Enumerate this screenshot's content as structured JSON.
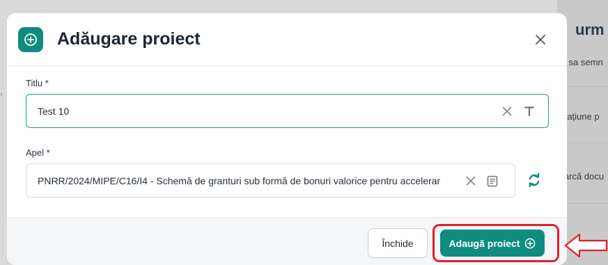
{
  "background": {
    "title": "urm",
    "lines": [
      "i sa semn",
      "rațiune p",
      "arcă docu"
    ]
  },
  "modal": {
    "title": "Adăugare proiect",
    "header_icon": "plus-circle-icon",
    "close_icon": "close-icon"
  },
  "form": {
    "title_field": {
      "label": "Titlu *",
      "value": "Test 10",
      "icons": [
        "clear-icon",
        "text-format-icon"
      ]
    },
    "apel_field": {
      "label": "Apel *",
      "value": "PNRR/2024/MIPE/C16/I4 - Schemă de granturi sub formă de bonuri valorice pentru accelerar",
      "icons": [
        "clear-icon",
        "document-list-icon"
      ]
    },
    "refresh_icon": "refresh-icon"
  },
  "footer": {
    "close_label": "Închide",
    "add_label": "Adaugă proiect"
  },
  "colors": {
    "accent": "#0f8c80",
    "highlight": "#e0202a"
  }
}
